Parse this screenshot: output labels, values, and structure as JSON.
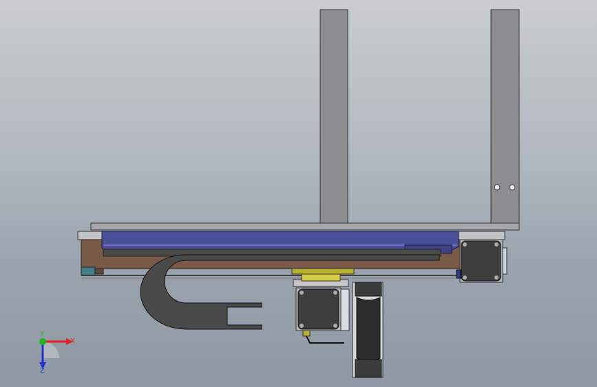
{
  "viewport": {
    "background_top": "#c9cdd1",
    "background_bottom": "#8e98a3"
  },
  "triad": {
    "x_label": "X",
    "y_label": "Y",
    "z_label": "Z",
    "x_color": "#e0201e",
    "y_color": "#1fb51f",
    "z_color": "#1f33d0"
  },
  "colors": {
    "frame_steel": "#8d8d91",
    "base_plate": "#a7a7aa",
    "linear_rail_blue": "#4a4f9a",
    "wood_panel": "#7a5a48",
    "stepper_motor": "#3d3d3d",
    "cable_chain": "#4a4a4a",
    "brass_coupler": "#b8b030"
  }
}
